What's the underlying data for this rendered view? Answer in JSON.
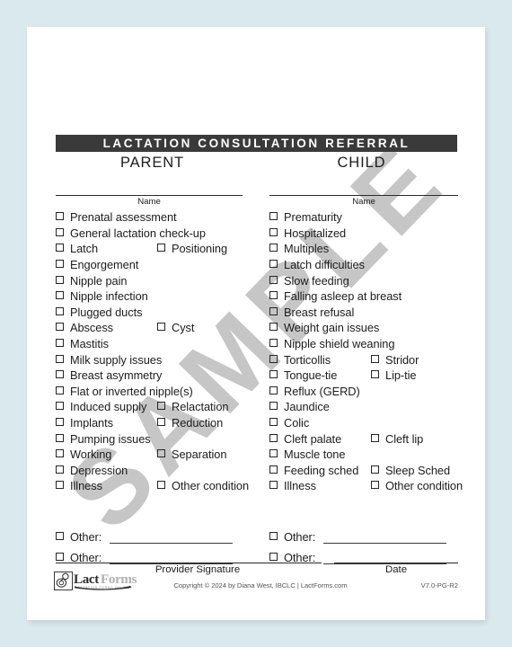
{
  "document": {
    "title": "LACTATION CONSULTATION REFERRAL",
    "columns": {
      "parent": "PARENT",
      "child": "CHILD"
    },
    "name_label_left": "Name",
    "name_label_right": "Name"
  },
  "parent_column": {
    "items": [
      {
        "label": "Prenatal assessment"
      },
      {
        "label": "General lactation check-up"
      },
      {
        "label": "Latch",
        "second": "Positioning"
      },
      {
        "label": "Engorgement"
      },
      {
        "label": "Nipple pain"
      },
      {
        "label": "Nipple infection"
      },
      {
        "label": "Plugged ducts"
      },
      {
        "label": "Abscess",
        "second": "Cyst"
      },
      {
        "label": "Mastitis"
      },
      {
        "label": "Milk supply issues"
      },
      {
        "label": "Breast asymmetry"
      },
      {
        "label": "Flat or inverted nipple(s)"
      },
      {
        "label": "Induced supply",
        "second": "Relactation"
      },
      {
        "label": "Implants",
        "second": "Reduction"
      },
      {
        "label": "Pumping issues"
      },
      {
        "label": "Working",
        "second": "Separation"
      },
      {
        "label": "Depression"
      },
      {
        "label": "Illness",
        "second": "Other condition"
      }
    ],
    "other_rows": [
      {
        "label": "Other:"
      },
      {
        "label": "Other:"
      }
    ]
  },
  "child_column": {
    "items": [
      {
        "label": "Prematurity"
      },
      {
        "label": "Hospitalized"
      },
      {
        "label": "Multiples"
      },
      {
        "label": "Latch difficulties"
      },
      {
        "label": "Slow feeding"
      },
      {
        "label": "Falling asleep at breast"
      },
      {
        "label": "Breast refusal"
      },
      {
        "label": "Weight gain issues"
      },
      {
        "label": "Nipple shield weaning"
      },
      {
        "label": "Torticollis",
        "second": "Stridor"
      },
      {
        "label": "Tongue-tie",
        "second": "Lip-tie"
      },
      {
        "label": "Reflux (GERD)"
      },
      {
        "label": "Jaundice"
      },
      {
        "label": "Colic"
      },
      {
        "label": "Cleft palate",
        "second": "Cleft lip"
      },
      {
        "label": "Muscle tone"
      },
      {
        "label": "Feeding sched",
        "second": "Sleep Sched"
      },
      {
        "label": "Illness",
        "second": "Other condition"
      }
    ],
    "other_rows": [
      {
        "label": "Other:"
      },
      {
        "label": "Other:"
      }
    ]
  },
  "signature": {
    "provider_label": "Provider Signature",
    "date_label": "Date"
  },
  "footer": {
    "copyright": "Copyright © 2024 by Diana West, IBCLC  |  LactForms.com",
    "version": "V7.0-PG-R2",
    "logo_lact": "Lact",
    "logo_forms": "Forms",
    "logo_tagline": "LACTATION FORMS ONLINE"
  },
  "watermark": {
    "text": "SAMPLE"
  },
  "colors": {
    "page_background": "#dae9ee",
    "paper": "#ffffff",
    "title_bar": "#3a3a3a",
    "text": "#1c1c1c",
    "watermark": "#b8b8b8",
    "muted": "#555555"
  }
}
